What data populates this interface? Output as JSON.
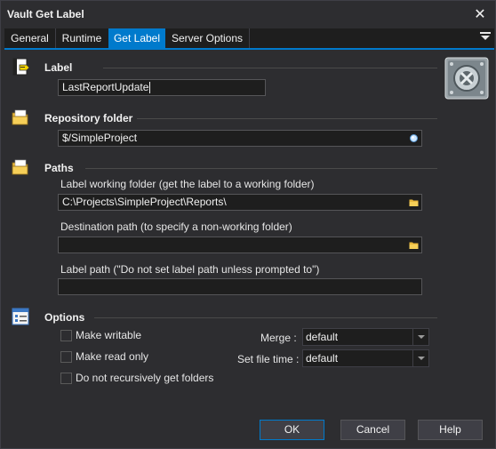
{
  "window": {
    "title": "Vault Get Label"
  },
  "tabs": [
    {
      "label": "General"
    },
    {
      "label": "Runtime"
    },
    {
      "label": "Get Label"
    },
    {
      "label": "Server Options"
    }
  ],
  "sections": {
    "label": {
      "title": "Label",
      "value": "LastReportUpdate"
    },
    "repository": {
      "title": "Repository folder",
      "value": "$/SimpleProject"
    },
    "paths": {
      "title": "Paths",
      "working_folder_label": "Label working folder (get the label to a working folder)",
      "working_folder_value": "C:\\Projects\\SimpleProject\\Reports\\",
      "destination_label": "Destination path (to specify a non-working folder)",
      "destination_value": "",
      "label_path_label": "Label path (\"Do not set label path unless prompted to\")",
      "label_path_value": ""
    },
    "options": {
      "title": "Options",
      "make_writable": "Make writable",
      "make_read_only": "Make read only",
      "no_recursive": "Do not recursively get folders",
      "merge_label": "Merge :",
      "merge_value": "default",
      "set_file_time_label": "Set file time :",
      "set_file_time_value": "default"
    }
  },
  "buttons": {
    "ok": "OK",
    "cancel": "Cancel",
    "help": "Help"
  },
  "colors": {
    "accent": "#007acc",
    "background": "#2d2d30",
    "field": "#1e1e1e"
  },
  "icons": [
    "label-tag-icon",
    "folder-icon",
    "options-list-icon",
    "robot-logo-icon",
    "close-icon",
    "tab-menu-icon"
  ]
}
